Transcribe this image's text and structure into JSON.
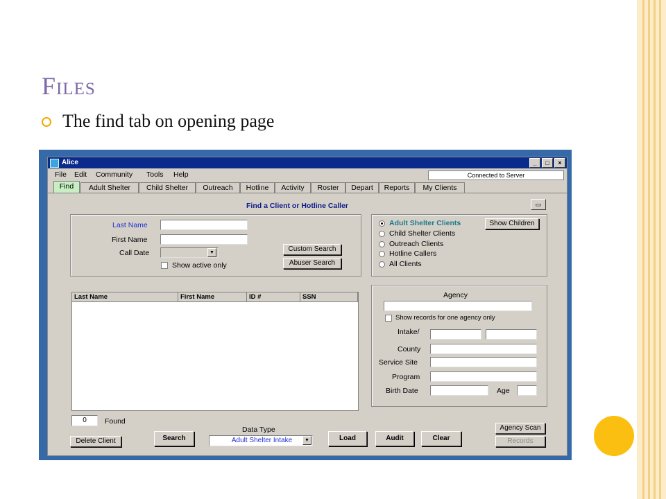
{
  "slide": {
    "title": "Files",
    "bullet": "The find tab on opening page"
  },
  "window": {
    "title": "Alice",
    "controls": [
      "_",
      "□",
      "×"
    ]
  },
  "menu": [
    "File",
    "Edit",
    "Community",
    "Tools",
    "Help"
  ],
  "connection_status": "Connected to Server",
  "tabs": [
    "Find",
    "Adult Shelter",
    "Child Shelter",
    "Outreach",
    "Hotline",
    "Activity",
    "Roster",
    "Depart",
    "Reports",
    "My Clients"
  ],
  "active_tab": "Find",
  "main": {
    "heading": "Find a Client or Hotline Caller"
  },
  "search_form": {
    "last_name_label": "Last Name",
    "first_name_label": "First Name",
    "call_date_label": "Call Date",
    "last_name_value": "",
    "first_name_value": "",
    "call_date_value": "",
    "show_active_label": "Show active only",
    "custom_search_label": "Custom Search",
    "abuser_search_label": "Abuser Search"
  },
  "client_types": {
    "options": [
      "Adult Shelter Clients",
      "Child Shelter Clients",
      "Outreach Clients",
      "Hotline Callers",
      "All Clients"
    ],
    "selected": "Adult Shelter Clients",
    "show_children_label": "Show Children",
    "selected_color": "#1a7a8a"
  },
  "results": {
    "columns": [
      "Last Name",
      "First Name",
      "ID #",
      "SSN"
    ],
    "rows": [],
    "count": "0",
    "found_label": "Found"
  },
  "agency": {
    "label": "Agency",
    "value": "",
    "show_one_agency_label": "Show records for one agency only",
    "intake_label": "Intake/",
    "county_label": "County",
    "service_site_label": "Service Site",
    "program_label": "Program",
    "birth_date_label": "Birth Date",
    "age_label": "Age"
  },
  "bottom": {
    "data_type_label": "Data Type",
    "data_type_value": "Adult Shelter Intake",
    "delete_client_label": "Delete Client",
    "search_label": "Search",
    "load_label": "Load",
    "audit_label": "Audit",
    "clear_label": "Clear",
    "agency_scan_label": "Agency Scan",
    "records_label": "Records"
  },
  "colors": {
    "frame": "#3569a7",
    "titlebar": "#0b2b8c",
    "heading": "#0d1b8a",
    "slide_title": "#7d68a8",
    "accent_dot": "#fbbf11"
  }
}
